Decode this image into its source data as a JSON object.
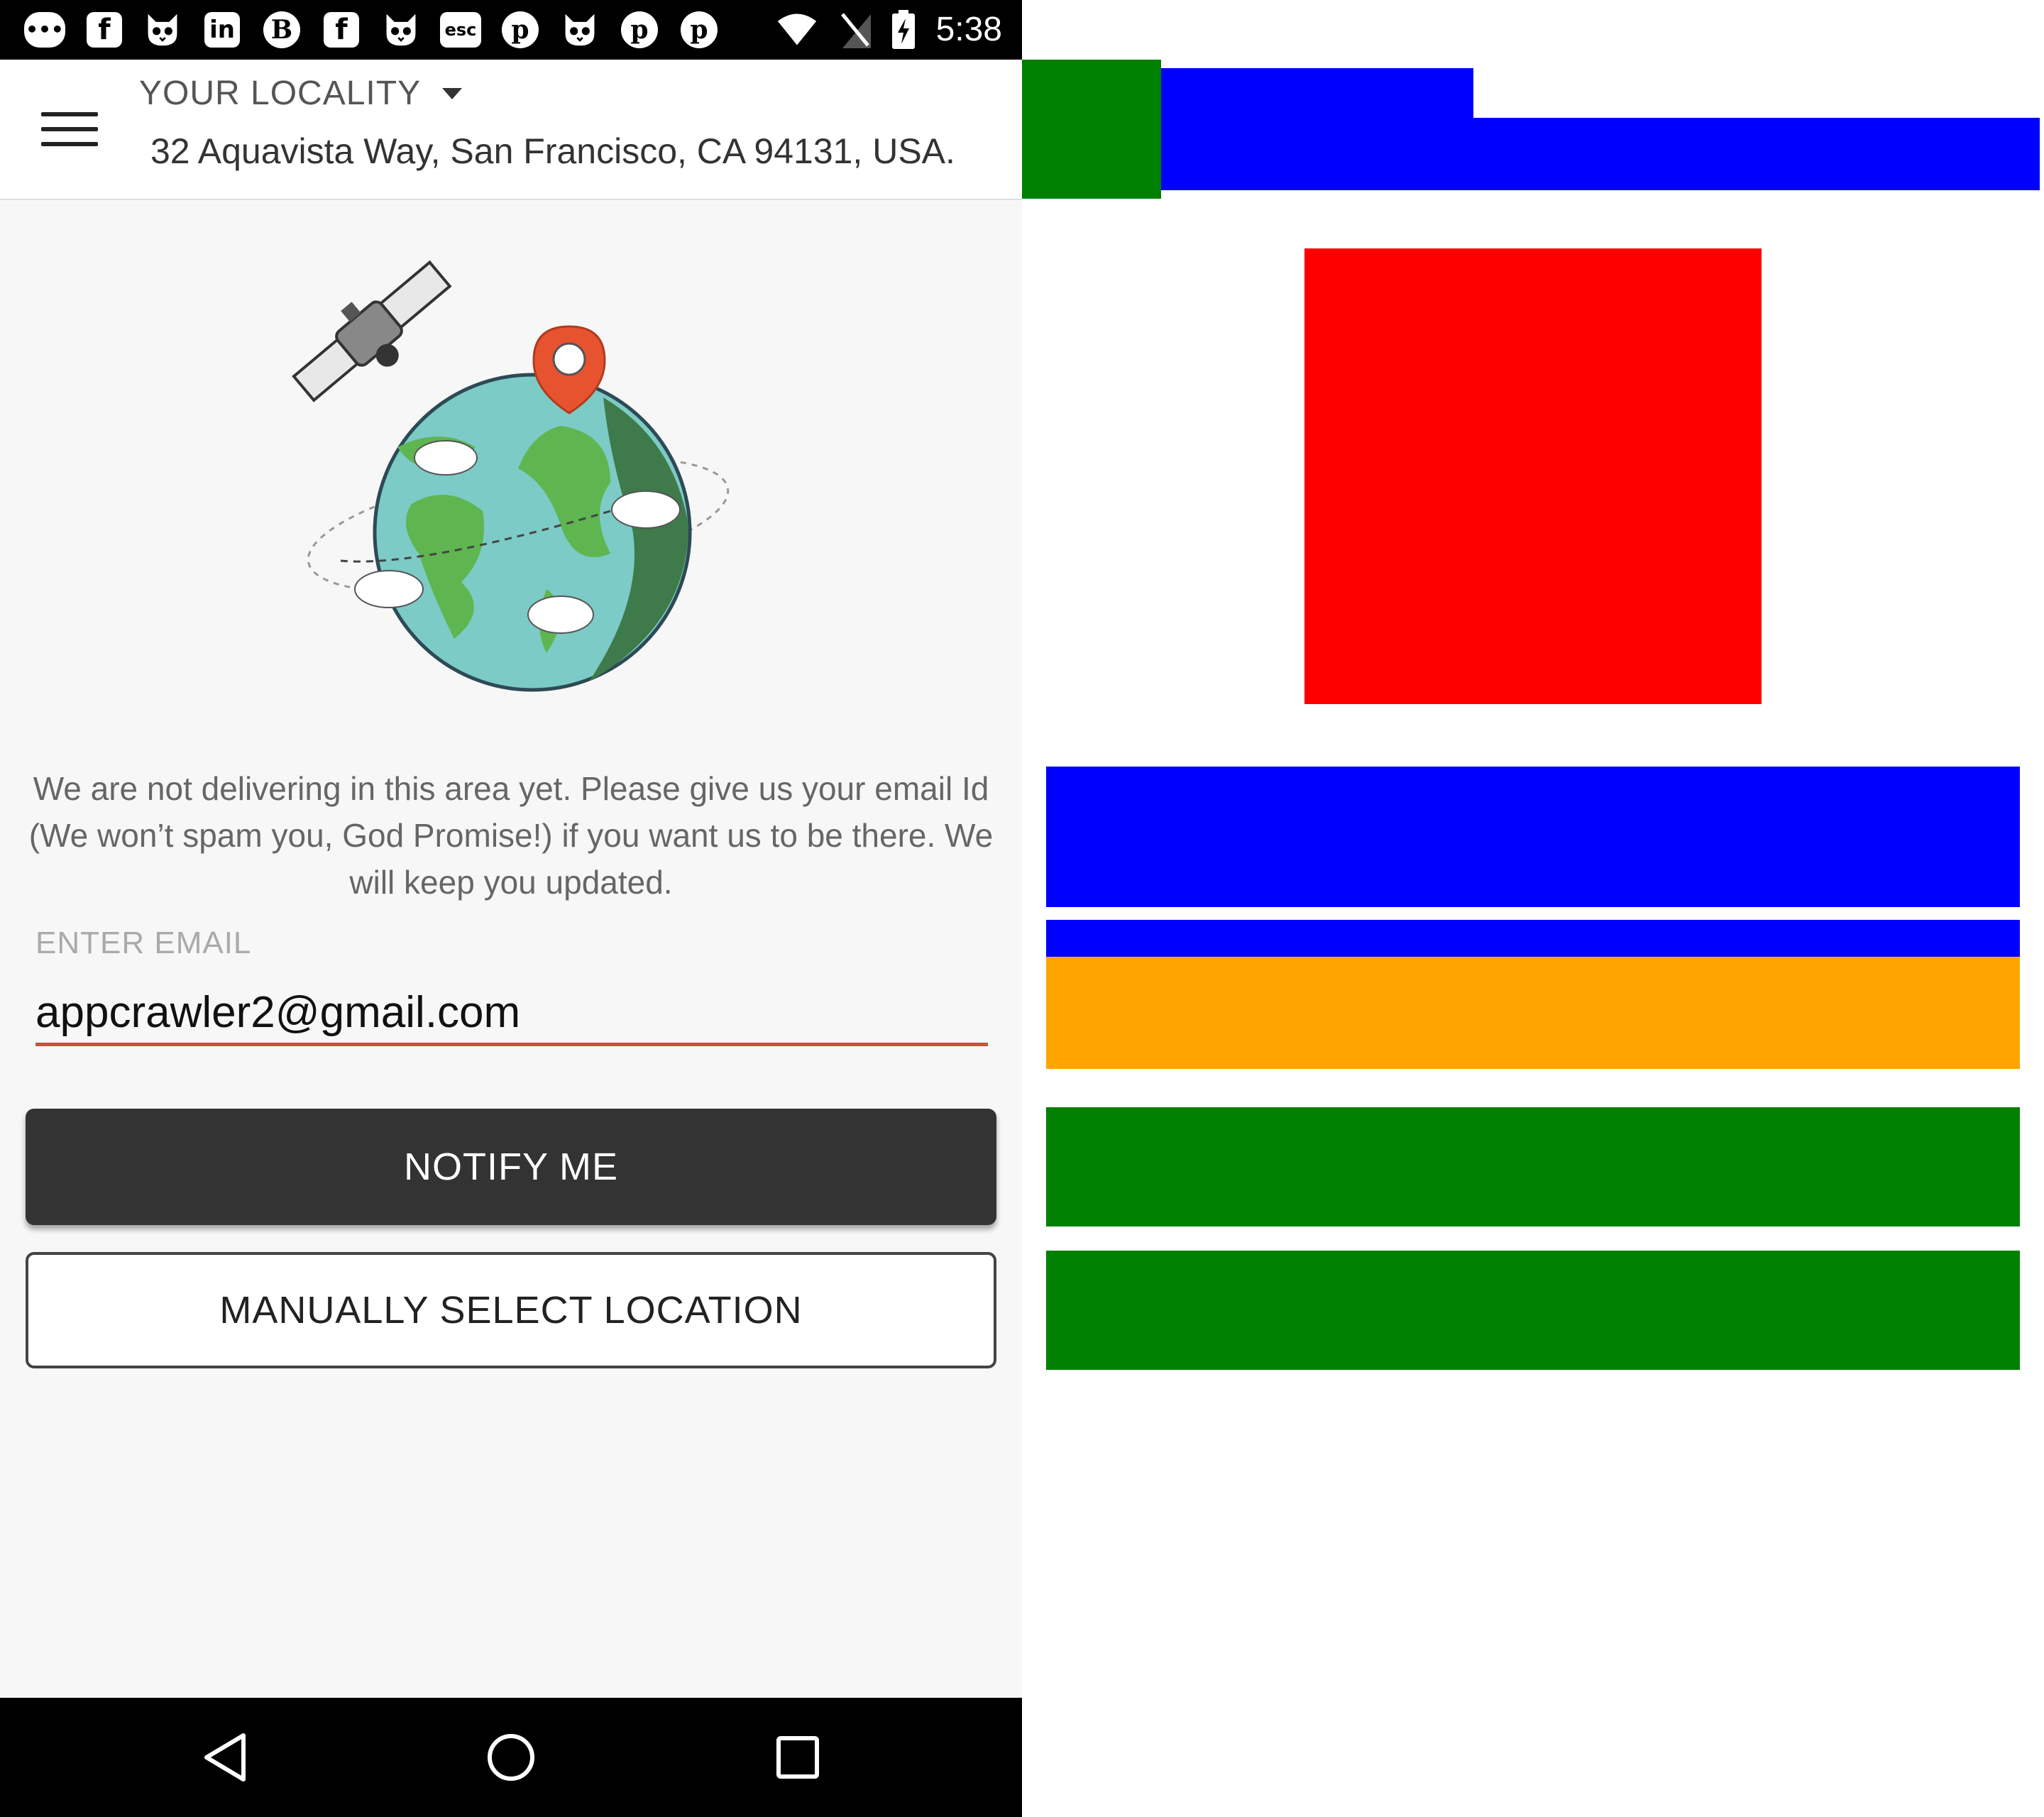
{
  "status_bar": {
    "time": "5:38",
    "notification_icons": [
      "messaging-icon",
      "facebook-icon",
      "cat-face-icon",
      "linkedin-icon",
      "b-chat-icon",
      "facebook-icon",
      "cat-face-icon",
      "esc-icon",
      "pinterest-icon",
      "cat-face-icon",
      "pinterest-icon",
      "pinterest-icon"
    ],
    "system_icons": [
      "wifi-icon",
      "no-sim-icon",
      "battery-charging-icon"
    ],
    "esc_label": "esc",
    "b_label": "B",
    "in_label": "in",
    "f_label": "f",
    "p_label": "p",
    "msg_label": "•••"
  },
  "header": {
    "locality_label": "YOUR LOCALITY",
    "address": "32 Aquavista Way, San Francisco, CA 94131, USA."
  },
  "main": {
    "message": "We are not delivering in this area yet. Please give us your email Id (We won’t spam you, God Promise!) if you want us to be there. We will keep you updated.",
    "email_label": "ENTER EMAIL",
    "email_value": "appcrawler2@gmail.com",
    "notify_button": "NOTIFY ME",
    "manual_button": "MANUALLY SELECT LOCATION"
  },
  "nav": {
    "icons": [
      "back-icon",
      "home-icon",
      "recents-icon"
    ]
  },
  "colors": {
    "accent_red": "#d9493c",
    "dark_button": "#333333",
    "overlay_green": "#008000",
    "overlay_blue": "#0000ff",
    "overlay_red": "#ff0000",
    "overlay_orange": "#ffa500"
  }
}
